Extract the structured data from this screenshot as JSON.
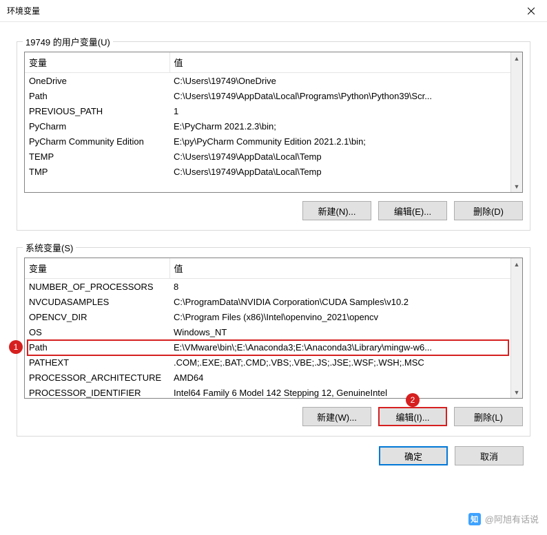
{
  "window": {
    "title": "环境变量"
  },
  "user_group": {
    "label": "19749 的用户变量(U)",
    "headers": {
      "var": "变量",
      "val": "值"
    },
    "rows": [
      {
        "var": "OneDrive",
        "val": "C:\\Users\\19749\\OneDrive"
      },
      {
        "var": "Path",
        "val": "C:\\Users\\19749\\AppData\\Local\\Programs\\Python\\Python39\\Scr..."
      },
      {
        "var": "PREVIOUS_PATH",
        "val": "1"
      },
      {
        "var": "PyCharm",
        "val": "E:\\PyCharm 2021.2.3\\bin;"
      },
      {
        "var": "PyCharm Community Edition",
        "val": "E:\\py\\PyCharm Community Edition 2021.2.1\\bin;"
      },
      {
        "var": "TEMP",
        "val": "C:\\Users\\19749\\AppData\\Local\\Temp"
      },
      {
        "var": "TMP",
        "val": "C:\\Users\\19749\\AppData\\Local\\Temp"
      }
    ],
    "buttons": {
      "new": "新建(N)...",
      "edit": "编辑(E)...",
      "delete": "删除(D)"
    }
  },
  "system_group": {
    "label": "系统变量(S)",
    "headers": {
      "var": "变量",
      "val": "值"
    },
    "rows": [
      {
        "var": "NUMBER_OF_PROCESSORS",
        "val": "8"
      },
      {
        "var": "NVCUDASAMPLES",
        "val": "C:\\ProgramData\\NVIDIA Corporation\\CUDA Samples\\v10.2"
      },
      {
        "var": "OPENCV_DIR",
        "val": "C:\\Program Files (x86)\\Intel\\openvino_2021\\opencv"
      },
      {
        "var": "OS",
        "val": "Windows_NT"
      },
      {
        "var": "Path",
        "val": "E:\\VMware\\bin\\;E:\\Anaconda3;E:\\Anaconda3\\Library\\mingw-w6..."
      },
      {
        "var": "PATHEXT",
        "val": ".COM;.EXE;.BAT;.CMD;.VBS;.VBE;.JS;.JSE;.WSF;.WSH;.MSC"
      },
      {
        "var": "PROCESSOR_ARCHITECTURE",
        "val": "AMD64"
      },
      {
        "var": "PROCESSOR_IDENTIFIER",
        "val": "Intel64 Family 6 Model 142 Stepping 12, GenuineIntel"
      }
    ],
    "buttons": {
      "new": "新建(W)...",
      "edit": "编辑(I)...",
      "delete": "删除(L)"
    }
  },
  "dialog_buttons": {
    "ok": "确定",
    "cancel": "取消"
  },
  "markers": {
    "m1": "1",
    "m2": "2"
  },
  "watermark": {
    "logo": "知",
    "text": "@阿旭有话说"
  }
}
